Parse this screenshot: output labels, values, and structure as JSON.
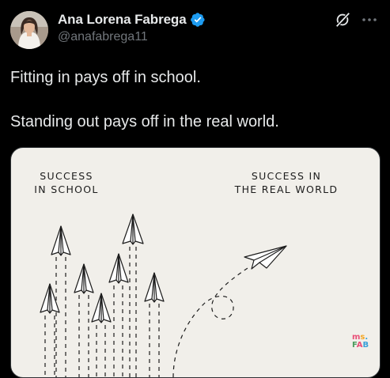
{
  "author": {
    "display_name": "Ana Lorena Fabrega",
    "handle": "@anafabrega11",
    "verified": true,
    "avatar_icon": "profile-photo-avatar"
  },
  "actions": {
    "grok_icon": "grok-icon",
    "more_icon": "more-options-icon"
  },
  "tweet": {
    "line_1": "Fitting in pays off in school.",
    "line_2": "Standing out pays off in the real world."
  },
  "image": {
    "left_label_line_1": "SUCCESS",
    "left_label_line_2": "IN SCHOOL",
    "right_label_line_1": "SUCCESS IN",
    "right_label_line_2": "THE REAL WORLD",
    "watermark": "ms. FAB"
  },
  "colors": {
    "background": "#000000",
    "text_primary": "#e7e9ea",
    "text_secondary": "#71767b",
    "verified_blue": "#1d9bf0",
    "card_background": "#f1efea"
  }
}
